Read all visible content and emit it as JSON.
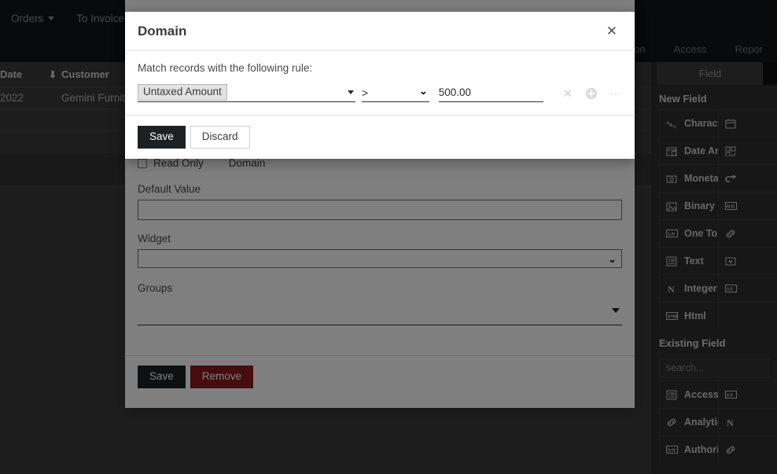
{
  "topbar": {
    "items": [
      {
        "label": "Orders",
        "caret": true
      },
      {
        "label": "To Invoice",
        "caret": true
      }
    ]
  },
  "subtabs": [
    {
      "label": "...mation"
    },
    {
      "label": "Access"
    },
    {
      "label": "Repor"
    }
  ],
  "list": {
    "columns": [
      "Date",
      "Customer"
    ],
    "sort_icon": "arrow-down-icon",
    "rows": [
      {
        "date": "2022",
        "customer": "Gemini Furnit.."
      },
      {
        "date": "",
        "customer": ""
      },
      {
        "date": "",
        "customer": ""
      },
      {
        "date": "",
        "customer": ""
      }
    ]
  },
  "right_panel": {
    "tab_label": "Field",
    "new_field_title": "New Field",
    "new_fields_left": [
      {
        "label": "Character",
        "icon": "abc-icon"
      },
      {
        "label": "Date And Time",
        "icon": "calendar-clock-icon"
      },
      {
        "label": "Monetary",
        "icon": "money-icon"
      },
      {
        "label": "Binary",
        "icon": "image-icon"
      },
      {
        "label": "One To Many",
        "icon": "one-to-many-icon"
      },
      {
        "label": "Text",
        "icon": "text-icon"
      },
      {
        "label": "Integer",
        "icon": "integer-icon"
      },
      {
        "label": "Html",
        "icon": "html-icon"
      }
    ],
    "new_fields_right": [
      {
        "label": "",
        "icon": "calendar-icon"
      },
      {
        "label": "",
        "icon": "checkboxes-icon"
      },
      {
        "label": "",
        "icon": "many-to-one-icon"
      },
      {
        "label": "",
        "icon": "n-to-n-icon"
      },
      {
        "label": "",
        "icon": "link-icon"
      },
      {
        "label": "",
        "icon": "selection-icon"
      },
      {
        "label": "",
        "icon": "decimal-icon"
      }
    ],
    "existing_field_title": "Existing Field",
    "search_placeholder": "search...",
    "existing_fields_left": [
      {
        "label": "Access warning",
        "icon": "text-icon"
      },
      {
        "label": "Analytic Acco...",
        "icon": "link-icon"
      },
      {
        "label": "Authorized Tr...",
        "icon": "n-to-n-icon"
      }
    ],
    "existing_fields_right": [
      {
        "label": "",
        "icon": "decimal-icon"
      },
      {
        "label": "",
        "icon": "integer-icon"
      },
      {
        "label": "",
        "icon": "link-icon"
      }
    ]
  },
  "bg_dialog": {
    "readonly_label": "Read Only",
    "domain_label": "Domain",
    "default_value_label": "Default Value",
    "default_value": "",
    "widget_label": "Widget",
    "widget_value": "",
    "groups_label": "Groups",
    "groups_value": "",
    "save_label": "Save",
    "remove_label": "Remove"
  },
  "modal": {
    "title": "Domain",
    "close_icon": "close-icon",
    "match_text": "Match records with the following rule:",
    "rule": {
      "field": "Untaxed Amount",
      "operator": ">",
      "value": "500.00",
      "delete_icon": "close-icon",
      "add_icon": "plus-circle-icon",
      "more_icon": "ellipsis-icon"
    },
    "save_label": "Save",
    "discard_label": "Discard"
  },
  "colors": {
    "accent_dark": "#1d2124",
    "danger": "#8b1a1a",
    "topbar": "#111418",
    "panel": "#2f2f2f"
  }
}
